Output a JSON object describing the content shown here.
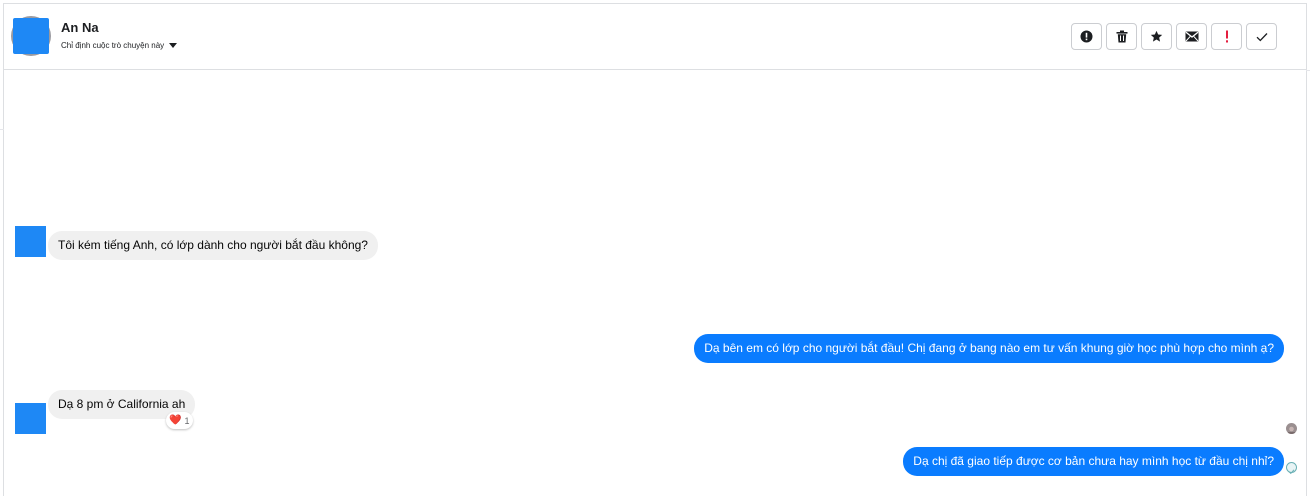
{
  "header": {
    "contact_name": "An Na",
    "assign_label": "Chỉ định cuộc trò chuyện này",
    "toolbar_icons": [
      "info-circle-icon",
      "trash-icon",
      "star-icon",
      "envelope-icon",
      "exclamation-icon",
      "check-icon"
    ]
  },
  "conversation": {
    "messages": [
      {
        "from": "contact",
        "text": "Tôi kém tiếng Anh, có lớp dành cho người bắt đầu không?"
      },
      {
        "from": "page",
        "text": "Dạ bên em có lớp cho người bắt đầu! Chị đang ở bang nào em tư vấn khung giờ học phù hợp cho mình ạ?"
      },
      {
        "from": "contact",
        "text": "Dạ 8 pm ở California ah",
        "reaction": {
          "emoji": "❤️",
          "count": "1"
        }
      },
      {
        "from": "page",
        "text": "Dạ chị đã giao tiếp được cơ bản chưa hay mình học từ đầu chị nhỉ?"
      }
    ]
  },
  "colors": {
    "outgoing_bubble": "#0a7cff",
    "incoming_bubble": "#f0f0f0",
    "avatar_placeholder": "#1e88f5",
    "exclamation_red": "#e41e3f"
  }
}
